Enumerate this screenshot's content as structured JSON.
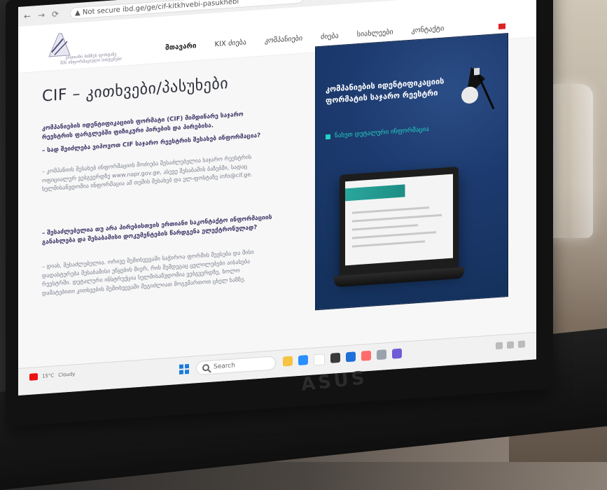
{
  "browser": {
    "security": "Not secure",
    "url": "ibd.ge/ge/cif-kitkhvebi-pasukhebi"
  },
  "header": {
    "logo_lines": [
      "ერთიანი ბიზნეს ფოსტაზე",
      "შპს ინფორმაციული სისტემები"
    ],
    "menu": [
      "მთავარი",
      "KIX ძიება",
      "კომპანიები",
      "ძიება",
      "სიახლეები",
      "კონტაქტი"
    ]
  },
  "content": {
    "title": "CIF – კითხვები/პასუხები",
    "lead": "კომპანიების იდენტიფიკაციის ფორმატი (CIF) მიმდინარე საჯარო რეესტრის ფარგლებში ფიზიკური პირების და პირებისა.",
    "q1": "– სად შეიძლება ვიპოვოთ CIF საჯარო რეესტრის შესახებ ინფორმაცია?",
    "p1": "– კომპანიის შესახებ ინფორმაციის მოძიება შესაძლებელია საჯარო რეესტრის ოფიციალურ ვებგვერდზე www.napr.gov.ge, ასევე შესაბამის ბაზებში, სადაც ხელმისაწვდომია ინფორმაცია ამ თემის შესახებ და ელ-ფოსტაზე info@cif.ge.",
    "q2": "– შესაძლებელია თუ არა პირებისთვის ერთიანი საკონტაქტო ინფორმაციის განახლება და შესაბამისი დოკუმენტების წარდგენა ელექტრონულად?",
    "p2": "– დიახ, შესაძლებელია. ორივე შემთხვევაში საჭიროა ფორმის შევსება და მისი დადასტურება შესაბამისი უწყების მიერ, რის შემდეგაც ცვლილებები აისახება რეესტრში. დეტალური ინსტრუქცია ხელმისაწვდომია ვებგვერდზე, ხოლო დამატებითი კითხვების შემთხვევაში შეგიძლიათ მოგვმართოთ ცხელ ხაზზე."
  },
  "hero": {
    "title": "კომპანიების იდენტიფიკაციის ფორმატის საჯარო რეესტრი",
    "cta": "ნახეთ დეტალური ინფორმაცია"
  },
  "taskbar": {
    "weather_temp": "15°C",
    "weather_desc": "Cloudy",
    "search_placeholder": "Search",
    "icons": [
      "file-explorer-icon",
      "edge-icon",
      "chrome-icon",
      "store-icon",
      "mail-icon",
      "photos-icon",
      "settings-icon",
      "teams-icon"
    ]
  },
  "device": {
    "brand": "ASUS"
  }
}
